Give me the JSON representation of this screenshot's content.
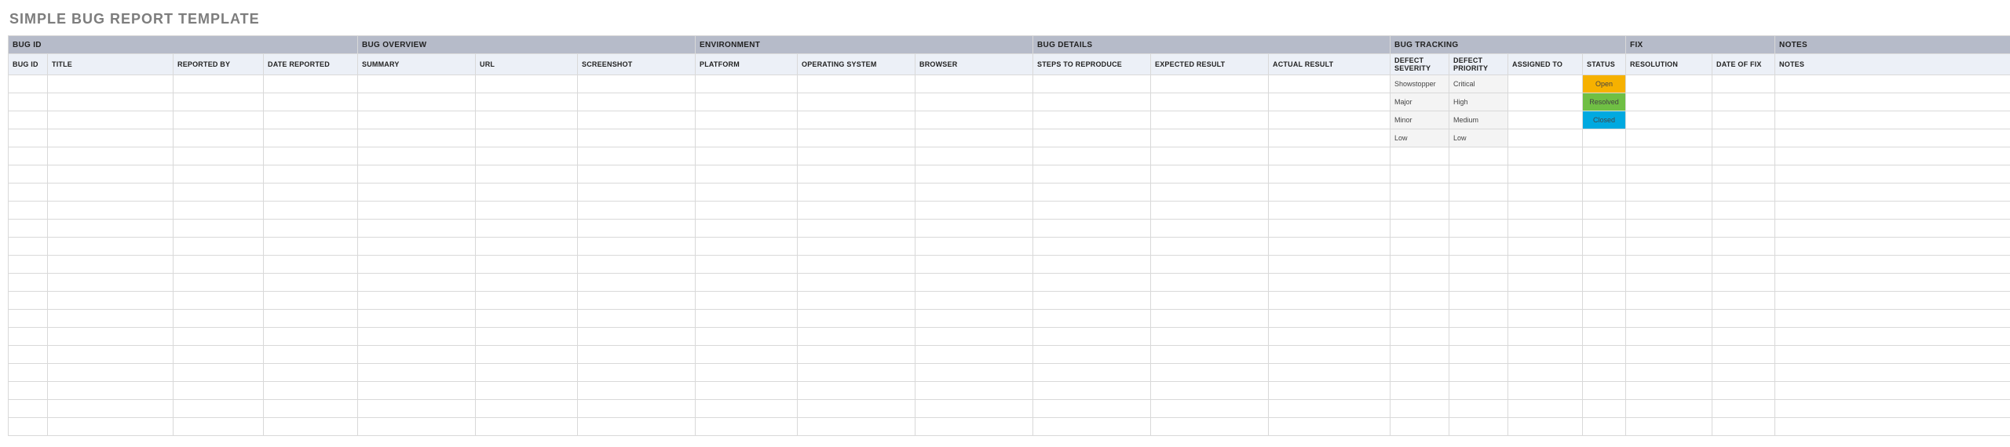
{
  "title": "SIMPLE BUG REPORT TEMPLATE",
  "groups": [
    {
      "label": "BUG ID",
      "span": 4
    },
    {
      "label": "BUG OVERVIEW",
      "span": 3
    },
    {
      "label": "ENVIRONMENT",
      "span": 3
    },
    {
      "label": "BUG DETAILS",
      "span": 3
    },
    {
      "label": "BUG TRACKING",
      "span": 4
    },
    {
      "label": "FIX",
      "span": 2
    },
    {
      "label": "NOTES",
      "span": 1
    }
  ],
  "columns": [
    "BUG ID",
    "TITLE",
    "REPORTED BY",
    "DATE REPORTED",
    "SUMMARY",
    "URL",
    "SCREENSHOT",
    "PLATFORM",
    "OPERATING SYSTEM",
    "BROWSER",
    "STEPS TO REPRODUCE",
    "EXPECTED RESULT",
    "ACTUAL RESULT",
    "DEFECT SEVERITY",
    "DEFECT PRIORITY",
    "ASSIGNED TO",
    "STATUS",
    "RESOLUTION",
    "DATE OF FIX",
    "NOTES"
  ],
  "rows": [
    {
      "severity": "Showstopper",
      "priority": "Critical",
      "status": "Open",
      "statusClass": "status-open"
    },
    {
      "severity": "Major",
      "priority": "High",
      "status": "Resolved",
      "statusClass": "status-resolved"
    },
    {
      "severity": "Minor",
      "priority": "Medium",
      "status": "Closed",
      "statusClass": "status-closed"
    },
    {
      "severity": "Low",
      "priority": "Low",
      "status": "",
      "statusClass": ""
    }
  ],
  "emptyRowCount": 16
}
